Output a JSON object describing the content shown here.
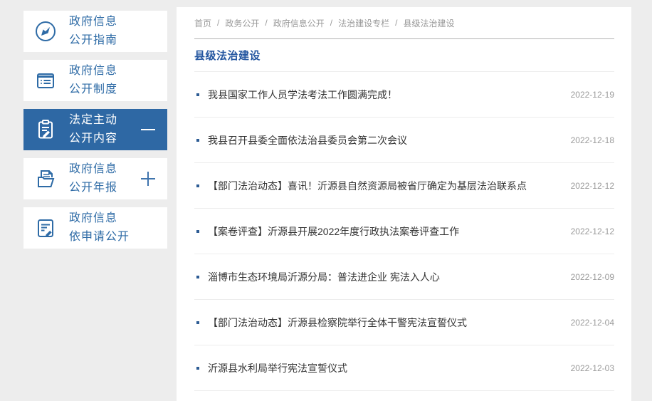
{
  "colors": {
    "page_bg": "#ededed",
    "accent_blue": "#2e68a4",
    "sidebar_text_blue": "#2e6ba6",
    "title_blue": "#2456a0",
    "list_text": "#333333",
    "muted_gray": "#999999"
  },
  "sidebar": {
    "items": [
      {
        "label": "政府信息\n公开指南",
        "icon": "compass-icon",
        "active": false,
        "toggle": "none"
      },
      {
        "label": "政府信息\n公开制度",
        "icon": "ledger-icon",
        "active": false,
        "toggle": "none"
      },
      {
        "label": "法定主动\n公开内容",
        "icon": "clipboard-pen-icon",
        "active": true,
        "toggle": "minus"
      },
      {
        "label": "政府信息\n公开年报",
        "icon": "folder-doc-icon",
        "active": false,
        "toggle": "plus"
      },
      {
        "label": "政府信息\n依申请公开",
        "icon": "doc-pen-icon",
        "active": false,
        "toggle": "none"
      }
    ]
  },
  "breadcrumb": {
    "separator": "/",
    "items": [
      "首页",
      "政务公开",
      "政府信息公开",
      "法治建设专栏",
      "县级法治建设"
    ]
  },
  "main": {
    "title": "县级法治建设",
    "articles": [
      {
        "title": "我县国家工作人员学法考法工作圆满完成！",
        "date": "2022-12-19"
      },
      {
        "title": "我县召开县委全面依法治县委员会第二次会议",
        "date": "2022-12-18"
      },
      {
        "title": "【部门法治动态】喜讯！沂源县自然资源局被省厅确定为基层法治联系点",
        "date": "2022-12-12"
      },
      {
        "title": "【案卷评查】沂源县开展2022年度行政执法案卷评查工作",
        "date": "2022-12-12"
      },
      {
        "title": "淄博市生态环境局沂源分局：普法进企业 宪法入人心",
        "date": "2022-12-09"
      },
      {
        "title": "【部门法治动态】沂源县检察院举行全体干警宪法宣誓仪式",
        "date": "2022-12-04"
      },
      {
        "title": "沂源县水利局举行宪法宣誓仪式",
        "date": "2022-12-03"
      }
    ]
  }
}
